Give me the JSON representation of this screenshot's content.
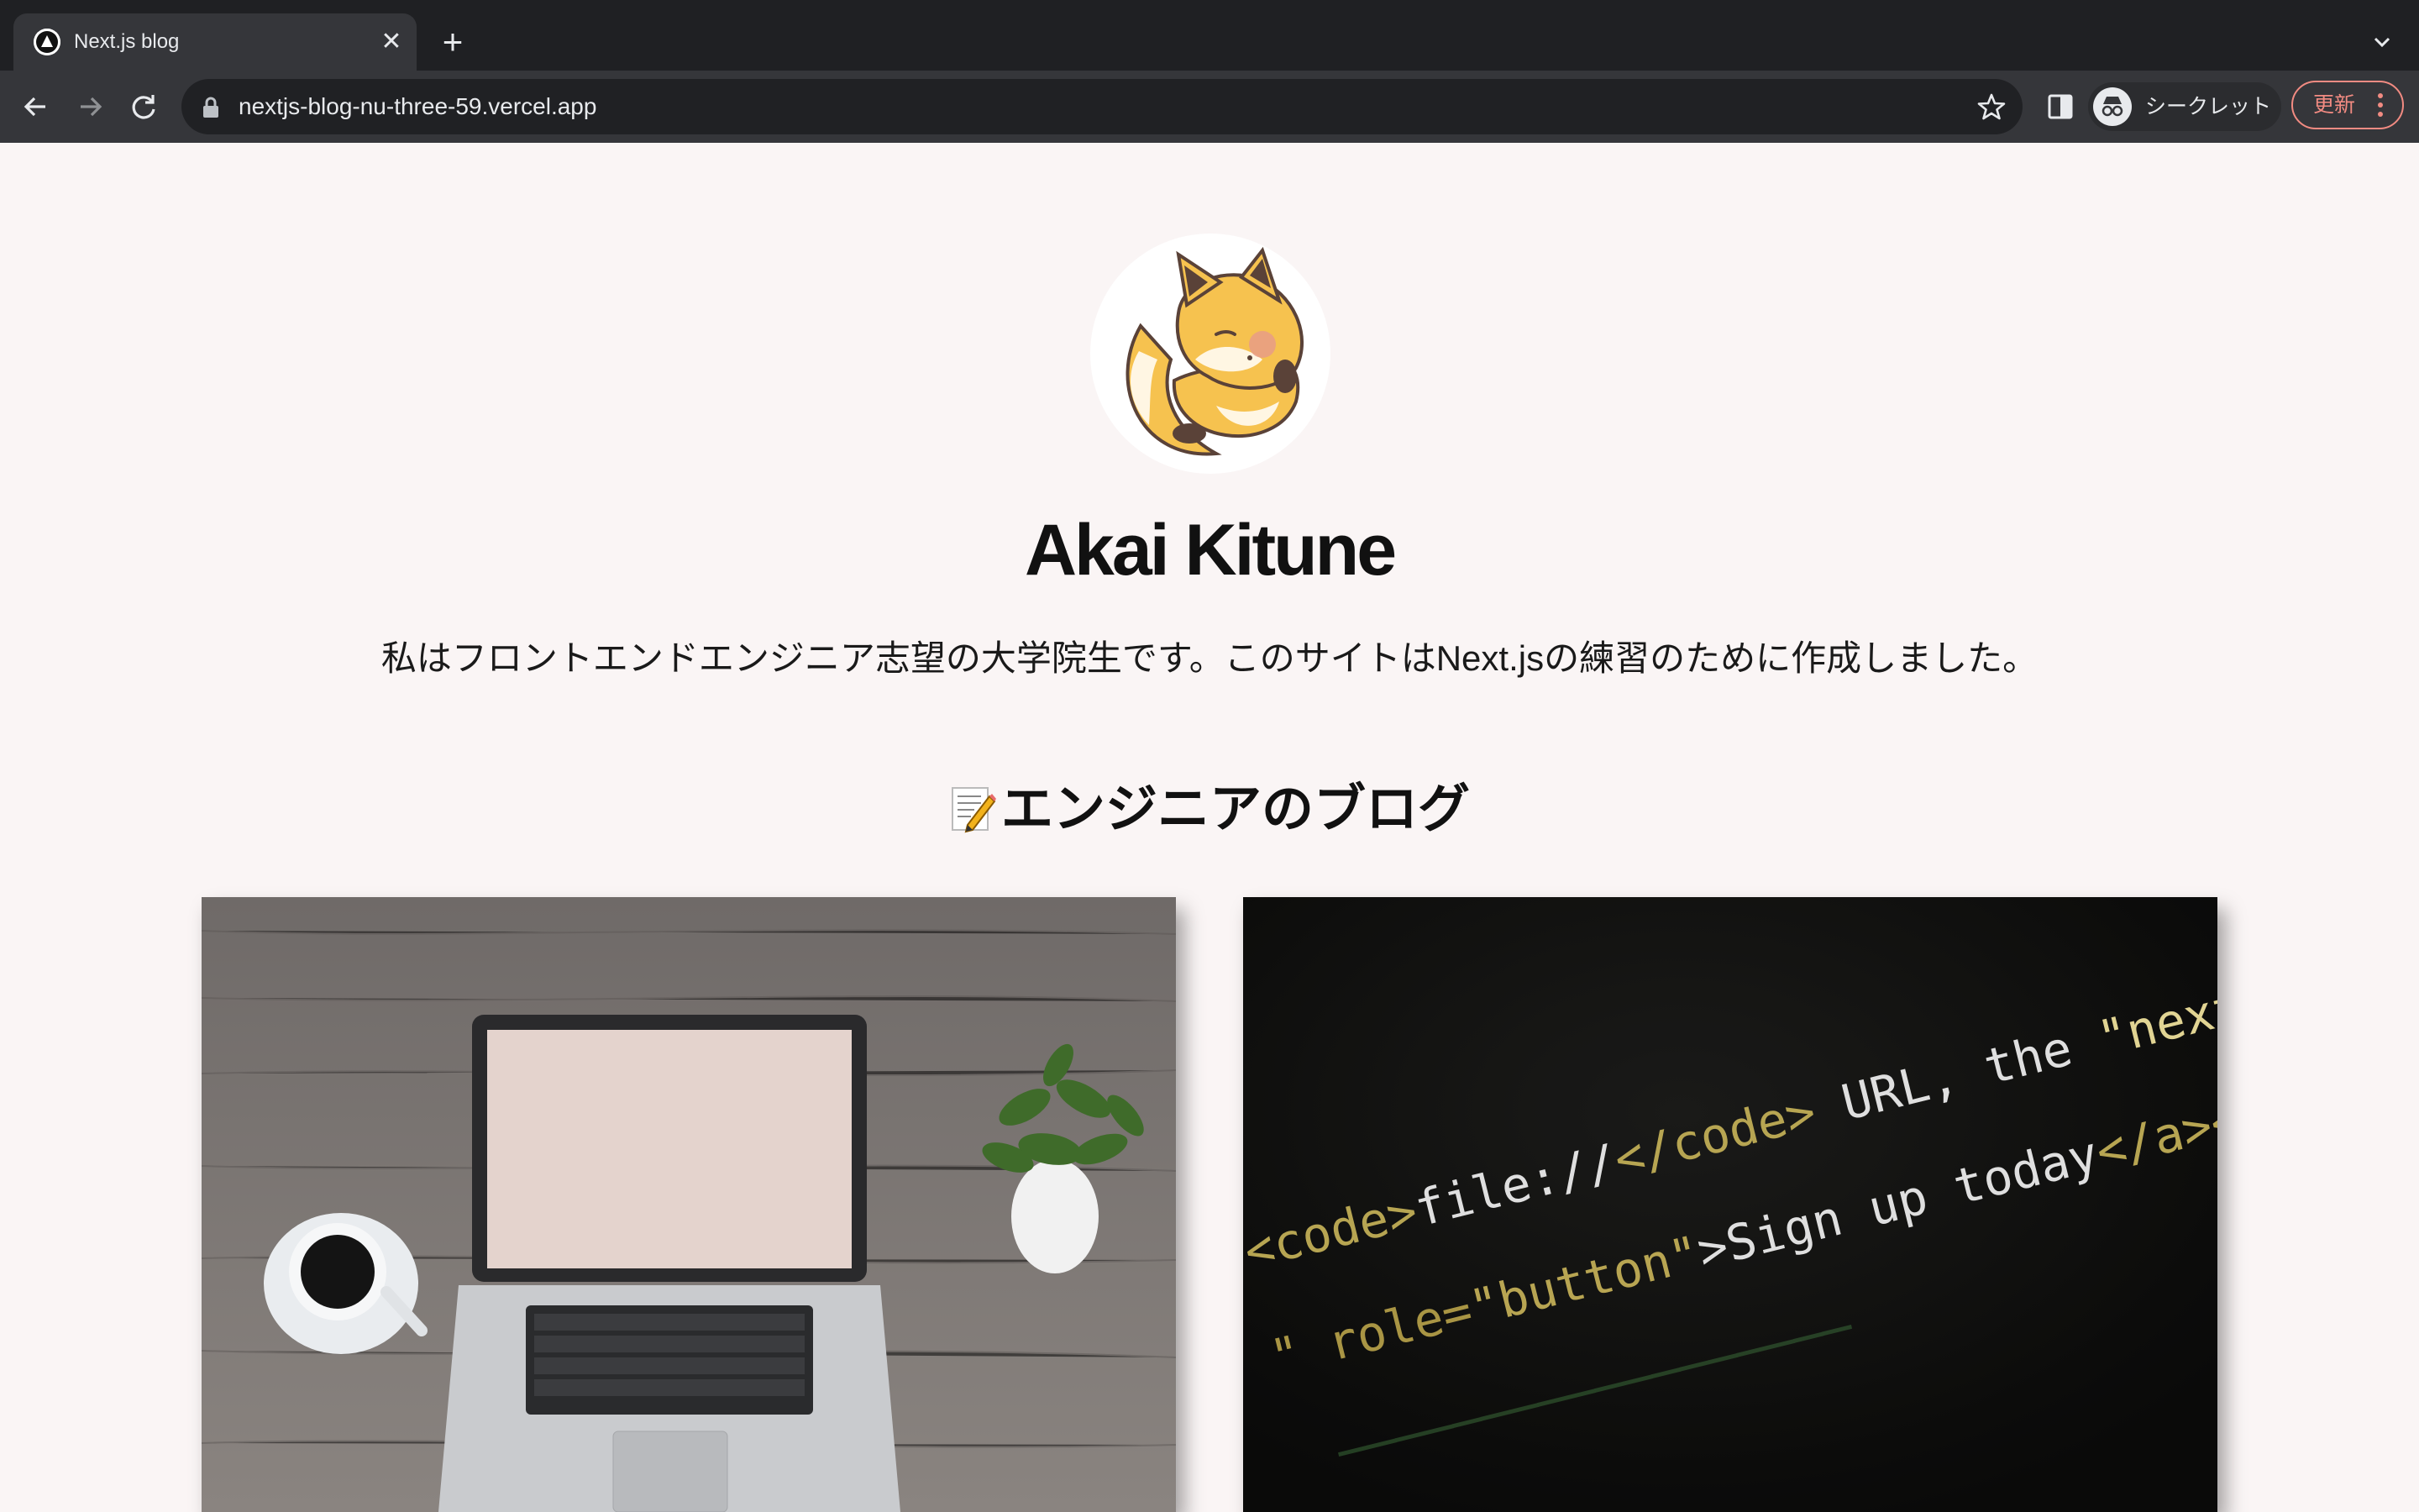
{
  "browser": {
    "tab_title": "Next.js blog",
    "url": "nextjs-blog-nu-three-59.vercel.app",
    "profile_label": "シークレット",
    "update_label": "更新"
  },
  "page": {
    "name": "Akai Kitune",
    "intro": "私はフロントエンドエンジニア志望の大学院生です。このサイトはNext.jsの練習のために作成しました。",
    "section_title": "エンジニアのブログ"
  },
  "cards": [
    {
      "image": "laptop-desk-photo"
    },
    {
      "image": "code-screen-photo",
      "code_lines": [
        "<code>file://</code> URL, the \"next\" a",
        "\" role=\"button\">Sign up today</a></p>"
      ]
    }
  ],
  "colors": {
    "page_bg": "#faf5f5",
    "chrome_dark": "#1f2023",
    "toolbar": "#35363a",
    "update_accent": "#f28b82"
  }
}
